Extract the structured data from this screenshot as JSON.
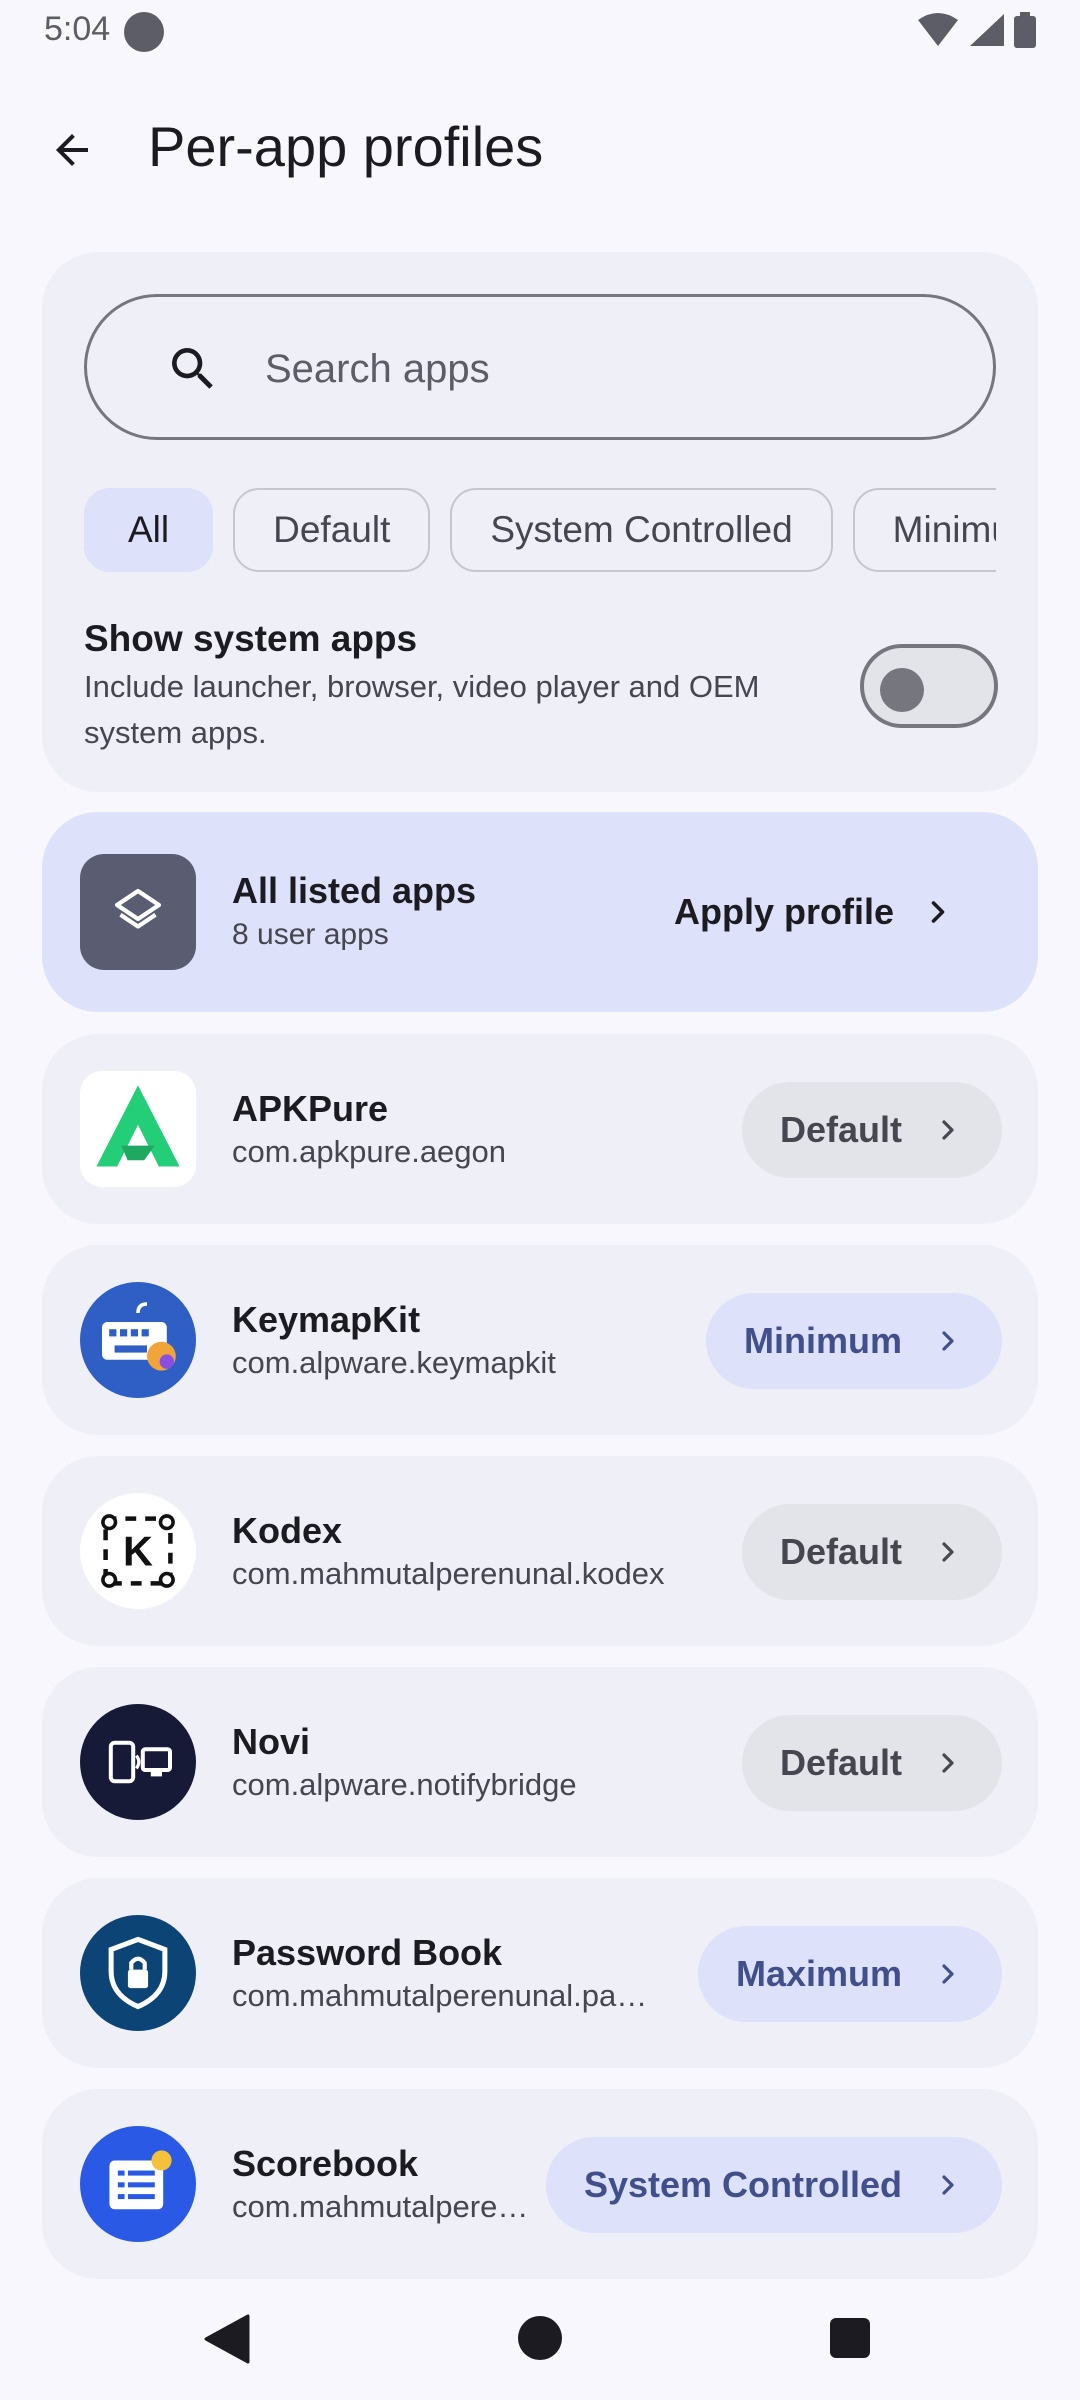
{
  "status_bar": {
    "time": "5:04"
  },
  "header": {
    "title": "Per-app profiles"
  },
  "search": {
    "placeholder": "Search apps",
    "value": ""
  },
  "filters": [
    {
      "label": "All",
      "selected": true
    },
    {
      "label": "Default",
      "selected": false
    },
    {
      "label": "System Controlled",
      "selected": false
    },
    {
      "label": "Minimum",
      "selected": false
    }
  ],
  "system_apps": {
    "title": "Show system apps",
    "description": "Include launcher, browser, video player and OEM system apps.",
    "enabled": false
  },
  "all_apps": {
    "title": "All listed apps",
    "subtitle": "8 user apps",
    "action": "Apply profile"
  },
  "apps": [
    {
      "name": "APKPure",
      "package": "com.apkpure.aegon",
      "profile": "Default",
      "icon": "apkpure-icon"
    },
    {
      "name": "KeymapKit",
      "package": "com.alpware.keymapkit",
      "profile": "Minimum",
      "icon": "keyboard-icon"
    },
    {
      "name": "Kodex",
      "package": "com.mahmutalperenunal.kodex",
      "profile": "Default",
      "icon": "kodex-icon"
    },
    {
      "name": "Novi",
      "package": "com.alpware.notifybridge",
      "profile": "Default",
      "icon": "devices-icon"
    },
    {
      "name": "Password Book",
      "package": "com.mahmutalperenunal.pa…",
      "profile": "Maximum",
      "icon": "shield-lock-icon"
    },
    {
      "name": "Scorebook",
      "package": "com.mahmutalpere…",
      "profile": "System Controlled",
      "icon": "scoreboard-icon"
    }
  ],
  "colors": {
    "background": "#f7f7fd",
    "card": "#efeff7",
    "accent_container": "#dde1f9",
    "accent_text": "#414f8a",
    "neutral_chip": "#e3e3ea"
  }
}
